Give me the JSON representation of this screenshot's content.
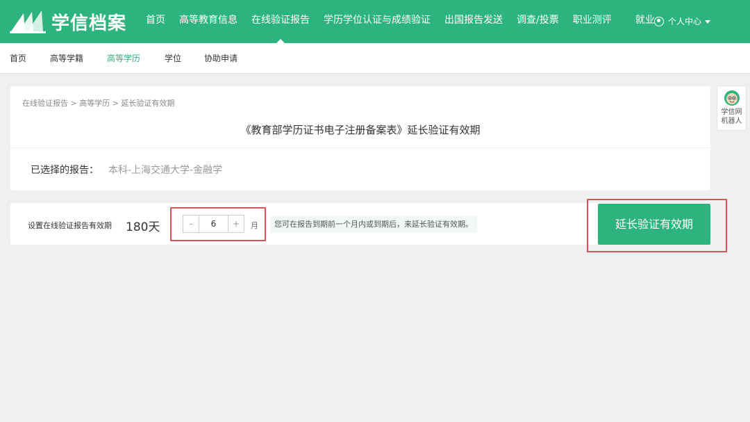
{
  "header": {
    "brand": "学信档案",
    "nav": [
      "首页",
      "高等教育信息",
      "在线验证报告",
      "学历学位认证与成绩验证",
      "出国报告发送",
      "调查/投票",
      "职业测评",
      "就业"
    ],
    "active_index": 2,
    "user_menu": "个人中心"
  },
  "subnav": {
    "items": [
      "首页",
      "高等学籍",
      "高等学历",
      "学位",
      "协助申请"
    ],
    "active_index": 2
  },
  "report_card": {
    "breadcrumb": "在线验证报告 > 高等学历 > 延长验证有效期",
    "title": "《教育部学历证书电子注册备案表》延长验证有效期",
    "selected_label": "已选择的报告：",
    "selected_value": "本科-上海交通大学-金融学"
  },
  "validity": {
    "label": "设置在线验证报告有效期",
    "days": "180天",
    "minus": "-",
    "months": "6",
    "plus": "+",
    "unit": "月",
    "hint": "您可在报告到期前一个月内或到期后，来延长验证有效期。",
    "extend_button": "延长验证有效期"
  },
  "robot": {
    "label_line1": "学信网",
    "label_line2": "机器人"
  },
  "colors": {
    "brand_green": "#2db37d",
    "highlight_red": "#d9534f",
    "background": "#f0f0f0"
  }
}
